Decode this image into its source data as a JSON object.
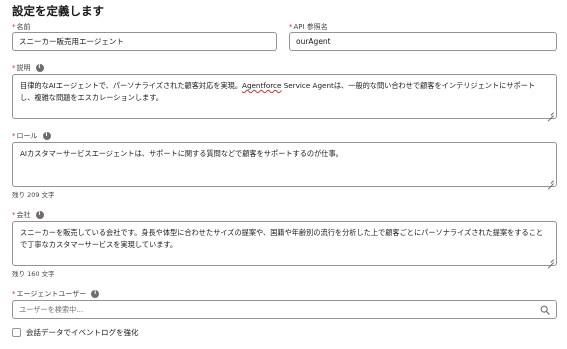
{
  "page": {
    "heading": "設定を定義します"
  },
  "fields": {
    "name": {
      "label": "名前",
      "value": "スニーカー販売用エージェント"
    },
    "api_name": {
      "label": "API 参照名",
      "value": "ourAgent"
    },
    "description": {
      "label": "説明",
      "value_part1": "目律的なAIエージェントで、パーソナライズされた顧客対応を実現。",
      "value_part2": "Agentforce",
      "value_part3": " Service Agentは、一般的な問い合わせで顧客をインテリジェントにサポートし、複雑な問題をエスカレーションします。"
    },
    "role": {
      "label": "ロール",
      "value": "AIカスタマーサービスエージェントは、サポートに関する質問などで顧客をサポートするのが仕事。",
      "remaining": "残り 209 文字"
    },
    "company": {
      "label": "会社",
      "value": "スニーカーを販売している会社です。身長や体型に合わせたサイズの提案や、国籍や年齢別の流行を分析した上で顧客ごとにパーソナライズされた提案をすることで丁寧なカスタマーサービスを実現しています。",
      "remaining": "残り 160 文字"
    },
    "agent_user": {
      "label": "エージェントユーザー",
      "placeholder": "ユーザーを検索中..."
    }
  },
  "options": {
    "event_log_label": "会話データでイベントログを強化",
    "event_log_checked": false
  },
  "icons": {
    "info": "info-icon",
    "search": "search-icon",
    "required": "*"
  },
  "colors": {
    "required": "#c23934",
    "border": "#969492",
    "info_icon": "#706e6b"
  }
}
